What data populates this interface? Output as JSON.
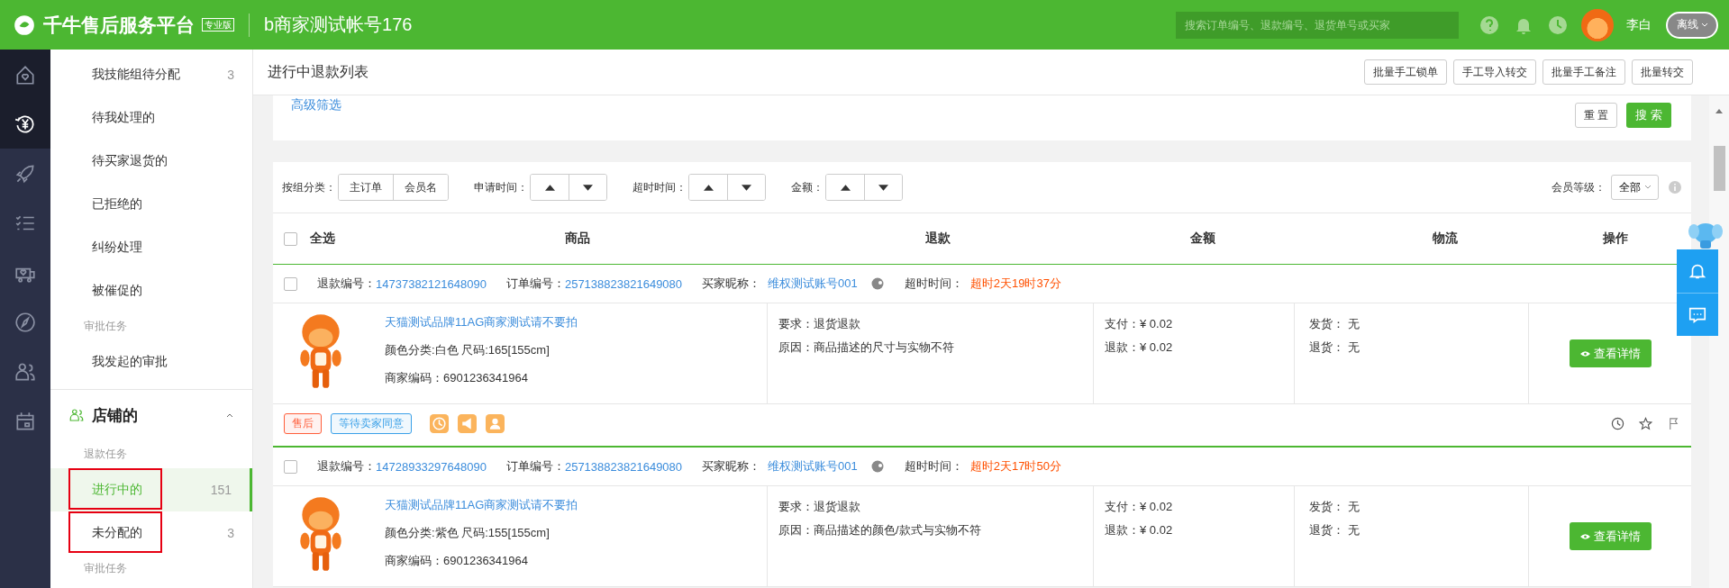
{
  "topbar": {
    "logo": "千牛售后服务平台",
    "edition": "专业版",
    "account": "b商家测试帐号176",
    "search_placeholder": "搜索订单编号、退款编号、退货单号或买家",
    "user": "李白",
    "status": "离线"
  },
  "rail": [
    {
      "kind": "home",
      "selected": false
    },
    {
      "kind": "yen",
      "selected": true
    },
    {
      "kind": "rocket",
      "selected": false
    },
    {
      "kind": "checklist",
      "selected": false
    },
    {
      "kind": "truck",
      "selected": false
    },
    {
      "kind": "compass",
      "selected": false
    },
    {
      "kind": "people",
      "selected": false
    },
    {
      "kind": "calendar",
      "selected": false
    }
  ],
  "sidebar": {
    "items": [
      {
        "kind": "item",
        "label": "我技能组待分配",
        "count": "3",
        "selected": false,
        "highlighted": false
      },
      {
        "kind": "item",
        "label": "待我处理的",
        "selected": false,
        "highlighted": false
      },
      {
        "kind": "item",
        "label": "待买家退货的",
        "selected": false,
        "highlighted": false
      },
      {
        "kind": "item",
        "label": "已拒绝的",
        "selected": false,
        "highlighted": false
      },
      {
        "kind": "item",
        "label": "纠纷处理",
        "selected": false,
        "highlighted": false
      },
      {
        "kind": "item",
        "label": "被催促的",
        "selected": false,
        "highlighted": false
      },
      {
        "kind": "section",
        "label": "审批任务"
      },
      {
        "kind": "item",
        "label": "我发起的审批",
        "selected": false,
        "highlighted": false
      }
    ],
    "shop": {
      "title": "店铺的",
      "expanded": true,
      "items": [
        {
          "kind": "section",
          "label": "退款任务"
        },
        {
          "kind": "item",
          "label": "进行中的",
          "count": "151",
          "selected": true,
          "highlighted": true
        },
        {
          "kind": "item",
          "label": "未分配的",
          "count": "3",
          "selected": false,
          "highlighted": true
        },
        {
          "kind": "section",
          "label": "审批任务"
        }
      ]
    }
  },
  "page": {
    "title": "进行中退款列表",
    "actions": [
      "批量手工锁单",
      "手工导入转交",
      "批量手工备注",
      "批量转交"
    ]
  },
  "filter": {
    "link": "高级筛选",
    "reset": "重 置",
    "search": "搜 索"
  },
  "toolbar": {
    "group_label": "按组分类：",
    "groups": [
      "主订单",
      "会员名"
    ],
    "sorters": [
      "申请时间：",
      "超时时间：",
      "金额："
    ],
    "level_label": "会员等级：",
    "level_value": "全部"
  },
  "table": {
    "select_all": {
      "label": "全选",
      "checked": false
    },
    "columns": [
      "商品",
      "退款",
      "金额",
      "物流",
      "操作"
    ],
    "orders": [
      {
        "checked": false,
        "refund_label": "退款编号：",
        "refund_no": "14737382121648090",
        "order_label": "订单编号：",
        "order_no": "257138823821649080",
        "buyer_label": "买家昵称：",
        "buyer": "维权测试账号001",
        "timeout_label": "超时时间：",
        "timeout": "超时2天19时37分",
        "product": {
          "title": "天猫测试品牌11AG商家测试请不要拍",
          "spec": "颜色分类:白色 尺码:165[155cm]",
          "code": "商家编码：6901236341964"
        },
        "requirement": "要求：退货退款",
        "reason": "原因：商品描述的尺寸与实物不符",
        "pay": "支付：¥ 0.02",
        "refund": "退款：¥ 0.02",
        "ship": "发货： 无",
        "return": "退货： 无",
        "action": "查看详情",
        "tags": [
          {
            "label": "售后",
            "color": "#ff5f3b"
          },
          {
            "label": "等待卖家同意",
            "color": "#3aa0e8"
          }
        ]
      },
      {
        "checked": false,
        "refund_label": "退款编号：",
        "refund_no": "14728933297648090",
        "order_label": "订单编号：",
        "order_no": "257138823821649080",
        "buyer_label": "买家昵称：",
        "buyer": "维权测试账号001",
        "timeout_label": "超时时间：",
        "timeout": "超时2天17时50分",
        "product": {
          "title": "天猫测试品牌11AG商家测试请不要拍",
          "spec": "颜色分类:紫色 尺码:155[155cm]",
          "code": "商家编码：6901236341964"
        },
        "requirement": "要求：退货退款",
        "reason": "原因：商品描述的颜色/款式与实物不符",
        "pay": "支付：¥ 0.02",
        "refund": "退款：¥ 0.02",
        "ship": "发货： 无",
        "return": "退货： 无",
        "action": "查看详情"
      }
    ]
  }
}
